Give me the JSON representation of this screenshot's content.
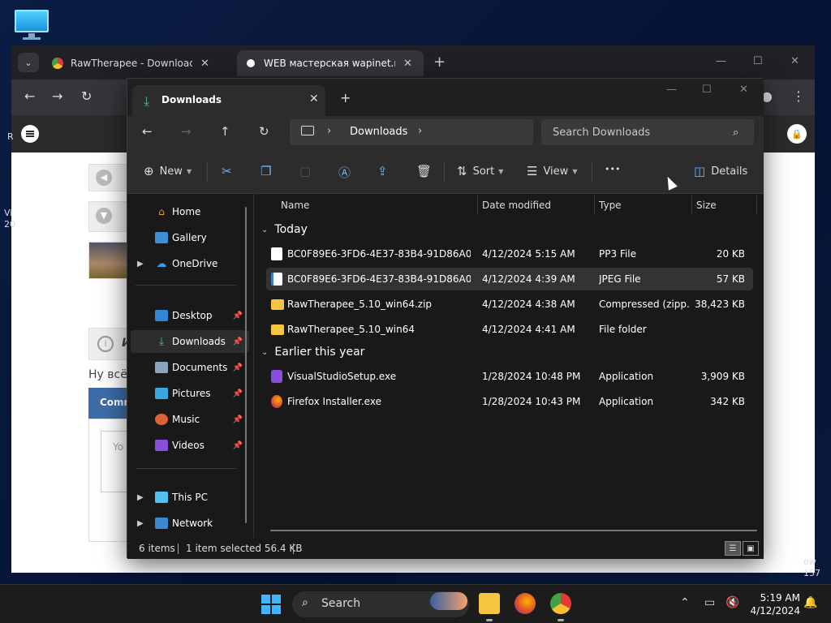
{
  "chrome": {
    "tabs": [
      {
        "label": "RawTherapee - Downloads"
      },
      {
        "label": "WEB мастерская wapinet.ru - Б"
      }
    ],
    "page": {
      "side_left": "Vi",
      "side_left2": "20",
      "side_right": "ew",
      "side_right2": "157",
      "letter_r": "R",
      "italic_i": "И",
      "text_line": "Ну всё",
      "comment_bar": "Comm",
      "input_hint": "Yo"
    }
  },
  "explorer": {
    "tab_title": "Downloads",
    "breadcrumb": "Downloads",
    "search_placeholder": "Search Downloads",
    "commands": {
      "new": "New",
      "sort": "Sort",
      "view": "View",
      "more": "•••",
      "details": "Details"
    },
    "nav": {
      "home": "Home",
      "gallery": "Gallery",
      "onedrive": "OneDrive",
      "desktop": "Desktop",
      "downloads": "Downloads",
      "documents": "Documents",
      "pictures": "Pictures",
      "music": "Music",
      "videos": "Videos",
      "thispc": "This PC",
      "network": "Network"
    },
    "columns": {
      "name": "Name",
      "date": "Date modified",
      "type": "Type",
      "size": "Size"
    },
    "groups": {
      "today": "Today",
      "earlier": "Earlier this year"
    },
    "files": [
      {
        "name": "BC0F89E6-3FD6-4E37-83B4-91D86A0D57...",
        "date": "4/12/2024 5:15 AM",
        "type": "PP3 File",
        "size": "20 KB"
      },
      {
        "name": "BC0F89E6-3FD6-4E37-83B4-91D86A0D57...",
        "date": "4/12/2024 4:39 AM",
        "type": "JPEG File",
        "size": "57 KB"
      },
      {
        "name": "RawTherapee_5.10_win64.zip",
        "date": "4/12/2024 4:38 AM",
        "type": "Compressed (zipp...",
        "size": "38,423 KB"
      },
      {
        "name": "RawTherapee_5.10_win64",
        "date": "4/12/2024 4:41 AM",
        "type": "File folder",
        "size": ""
      },
      {
        "name": "VisualStudioSetup.exe",
        "date": "1/28/2024 10:48 PM",
        "type": "Application",
        "size": "3,909 KB"
      },
      {
        "name": "Firefox Installer.exe",
        "date": "1/28/2024 10:43 PM",
        "type": "Application",
        "size": "342 KB"
      }
    ],
    "status": {
      "items": "6 items",
      "selected": "1 item selected  56.4 KB"
    }
  },
  "taskbar": {
    "search_label": "Search",
    "time": "5:19 AM",
    "date": "4/12/2024"
  },
  "colors": {
    "accent": "#4ec07a",
    "icon_blue": "#6ab8ff",
    "folder": "#f5c542"
  }
}
